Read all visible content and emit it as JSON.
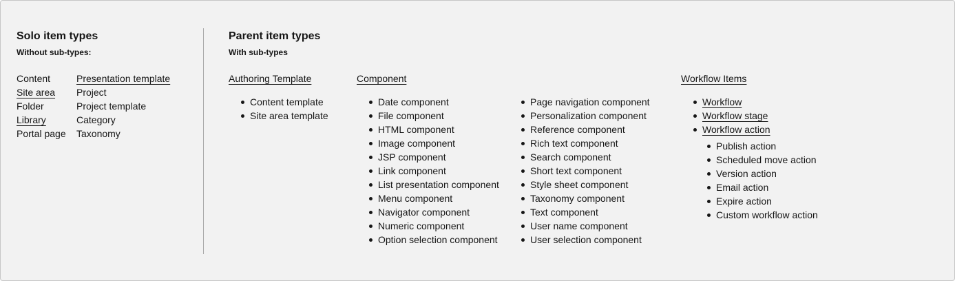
{
  "solo": {
    "title": "Solo item types",
    "subtitle": "Without sub-types:",
    "col1": [
      {
        "label": "Content",
        "link": false
      },
      {
        "label": "Site area",
        "link": true
      },
      {
        "label": "Folder",
        "link": false
      },
      {
        "label": "Library",
        "link": true
      },
      {
        "label": "Portal page",
        "link": false
      }
    ],
    "col2": [
      {
        "label": "Presentation template",
        "link": true
      },
      {
        "label": "Project",
        "link": false
      },
      {
        "label": "Project template",
        "link": false
      },
      {
        "label": "Category",
        "link": false
      },
      {
        "label": "Taxonomy",
        "link": false
      }
    ]
  },
  "parent": {
    "title": "Parent item types",
    "subtitle": "With sub-types",
    "authoring": {
      "heading": "Authoring Template",
      "items": [
        "Content template",
        "Site area template"
      ]
    },
    "component": {
      "heading": "Component",
      "items_a": [
        "Date component",
        "File component",
        "HTML component",
        "Image component",
        "JSP component",
        "Link component",
        "List presentation component",
        "Menu component",
        "Navigator component",
        "Numeric component",
        "Option selection component"
      ],
      "items_b": [
        "Page navigation component",
        "Personalization component",
        "Reference component",
        "Rich text component",
        "Search component",
        "Short text component",
        "Style sheet component",
        "Taxonomy component",
        "Text component",
        "User name component",
        "User selection component"
      ]
    },
    "workflow": {
      "heading": "Workflow Items",
      "items": [
        "Workflow",
        "Workflow stage",
        "Workflow action"
      ],
      "actions": [
        "Publish action",
        "Scheduled move action",
        "Version action",
        "Email action",
        "Expire action",
        "Custom workflow action"
      ]
    }
  }
}
